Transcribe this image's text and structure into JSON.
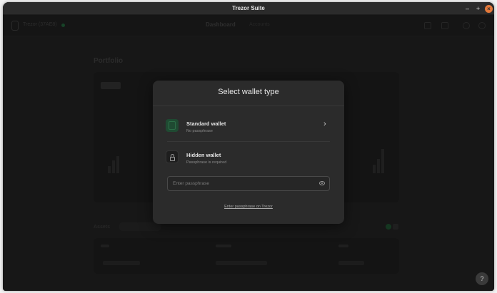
{
  "window": {
    "title": "Trezor Suite"
  },
  "appbar": {
    "device_name": "Trezor (37AE8)",
    "nav": {
      "dashboard": "Dashboard",
      "accounts": "Accounts"
    }
  },
  "background": {
    "portfolio_title": "Portfolio",
    "tabs_title": "Assets"
  },
  "modal": {
    "title": "Select wallet type",
    "standard": {
      "title": "Standard wallet",
      "subtitle": "No passphrase"
    },
    "hidden": {
      "title": "Hidden wallet",
      "subtitle": "Passphrase is required"
    },
    "passphrase_placeholder": "Enter passphrase",
    "trezor_link": "Enter passphrase on Trezor"
  },
  "colors": {
    "accent_green": "#1f4a32",
    "close_button": "#e5793a",
    "modal_bg": "#2b2b2b"
  }
}
